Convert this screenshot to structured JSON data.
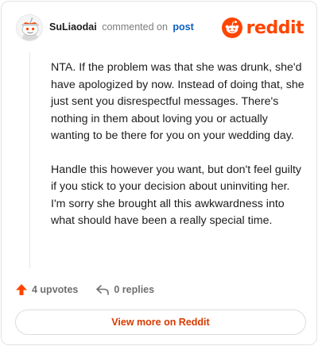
{
  "header": {
    "author": "SuLiaodai",
    "action_text": "commented on",
    "post_link": "post",
    "logo_text": "reddit"
  },
  "comment": {
    "paragraphs": [
      "NTA. If the problem was that she was drunk, she'd have apologized by now. Instead of doing that, she just sent you disrespectful messages. There's nothing in them about loving you or actually wanting to be there for you on your wedding day.",
      "Handle this however you want, but don't feel guilty if you stick to your decision about uninviting her. I'm sorry she brought all this awkwardness into what should have been a really special time."
    ]
  },
  "actions": {
    "upvotes": "4 upvotes",
    "replies": "0 replies"
  },
  "view_more_label": "View more on Reddit",
  "colors": {
    "brand": "#ff4500",
    "upvote": "#ff4500",
    "link": "#0b5fbf",
    "view_more_text": "#d93a00"
  },
  "icons": [
    "avatar-snoo-icon",
    "reddit-logo-icon",
    "upvote-arrow-icon",
    "reply-arrow-icon"
  ]
}
